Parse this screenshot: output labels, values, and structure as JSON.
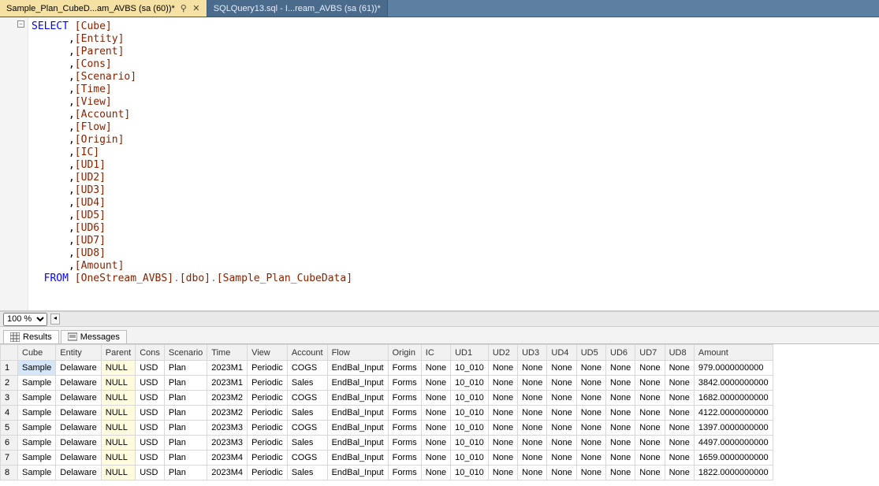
{
  "tabs": [
    {
      "label": "Sample_Plan_CubeD...am_AVBS (sa (60))*",
      "active": true,
      "pinned": true
    },
    {
      "label": "SQLQuery13.sql - I...ream_AVBS (sa (61))*",
      "active": false,
      "pinned": false
    }
  ],
  "editor": {
    "select_kw": "SELECT",
    "from_kw": "FROM",
    "first_col": "Cube",
    "columns_after": [
      "Entity",
      "Parent",
      "Cons",
      "Scenario",
      "Time",
      "View",
      "Account",
      "Flow",
      "Origin",
      "IC",
      "UD1",
      "UD2",
      "UD3",
      "UD4",
      "UD5",
      "UD6",
      "UD7",
      "UD8",
      "Amount"
    ],
    "from_db": "OneStream_AVBS",
    "from_schema": "dbo",
    "from_table": "Sample_Plan_CubeData"
  },
  "zoom": {
    "value": "100 %"
  },
  "result_tabs": {
    "results_label": "Results",
    "messages_label": "Messages"
  },
  "grid": {
    "headers": [
      "",
      "Cube",
      "Entity",
      "Parent",
      "Cons",
      "Scenario",
      "Time",
      "View",
      "Account",
      "Flow",
      "Origin",
      "IC",
      "UD1",
      "UD2",
      "UD3",
      "UD4",
      "UD5",
      "UD6",
      "UD7",
      "UD8",
      "Amount"
    ],
    "null_text": "NULL",
    "rows": [
      {
        "n": 1,
        "Cube": "Sample",
        "Entity": "Delaware",
        "Parent": null,
        "Cons": "USD",
        "Scenario": "Plan",
        "Time": "2023M1",
        "View": "Periodic",
        "Account": "COGS",
        "Flow": "EndBal_Input",
        "Origin": "Forms",
        "IC": "None",
        "UD1": "10_010",
        "UD2": "None",
        "UD3": "None",
        "UD4": "None",
        "UD5": "None",
        "UD6": "None",
        "UD7": "None",
        "UD8": "None",
        "Amount": "979.0000000000"
      },
      {
        "n": 2,
        "Cube": "Sample",
        "Entity": "Delaware",
        "Parent": null,
        "Cons": "USD",
        "Scenario": "Plan",
        "Time": "2023M1",
        "View": "Periodic",
        "Account": "Sales",
        "Flow": "EndBal_Input",
        "Origin": "Forms",
        "IC": "None",
        "UD1": "10_010",
        "UD2": "None",
        "UD3": "None",
        "UD4": "None",
        "UD5": "None",
        "UD6": "None",
        "UD7": "None",
        "UD8": "None",
        "Amount": "3842.0000000000"
      },
      {
        "n": 3,
        "Cube": "Sample",
        "Entity": "Delaware",
        "Parent": null,
        "Cons": "USD",
        "Scenario": "Plan",
        "Time": "2023M2",
        "View": "Periodic",
        "Account": "COGS",
        "Flow": "EndBal_Input",
        "Origin": "Forms",
        "IC": "None",
        "UD1": "10_010",
        "UD2": "None",
        "UD3": "None",
        "UD4": "None",
        "UD5": "None",
        "UD6": "None",
        "UD7": "None",
        "UD8": "None",
        "Amount": "1682.0000000000"
      },
      {
        "n": 4,
        "Cube": "Sample",
        "Entity": "Delaware",
        "Parent": null,
        "Cons": "USD",
        "Scenario": "Plan",
        "Time": "2023M2",
        "View": "Periodic",
        "Account": "Sales",
        "Flow": "EndBal_Input",
        "Origin": "Forms",
        "IC": "None",
        "UD1": "10_010",
        "UD2": "None",
        "UD3": "None",
        "UD4": "None",
        "UD5": "None",
        "UD6": "None",
        "UD7": "None",
        "UD8": "None",
        "Amount": "4122.0000000000"
      },
      {
        "n": 5,
        "Cube": "Sample",
        "Entity": "Delaware",
        "Parent": null,
        "Cons": "USD",
        "Scenario": "Plan",
        "Time": "2023M3",
        "View": "Periodic",
        "Account": "COGS",
        "Flow": "EndBal_Input",
        "Origin": "Forms",
        "IC": "None",
        "UD1": "10_010",
        "UD2": "None",
        "UD3": "None",
        "UD4": "None",
        "UD5": "None",
        "UD6": "None",
        "UD7": "None",
        "UD8": "None",
        "Amount": "1397.0000000000"
      },
      {
        "n": 6,
        "Cube": "Sample",
        "Entity": "Delaware",
        "Parent": null,
        "Cons": "USD",
        "Scenario": "Plan",
        "Time": "2023M3",
        "View": "Periodic",
        "Account": "Sales",
        "Flow": "EndBal_Input",
        "Origin": "Forms",
        "IC": "None",
        "UD1": "10_010",
        "UD2": "None",
        "UD3": "None",
        "UD4": "None",
        "UD5": "None",
        "UD6": "None",
        "UD7": "None",
        "UD8": "None",
        "Amount": "4497.0000000000"
      },
      {
        "n": 7,
        "Cube": "Sample",
        "Entity": "Delaware",
        "Parent": null,
        "Cons": "USD",
        "Scenario": "Plan",
        "Time": "2023M4",
        "View": "Periodic",
        "Account": "COGS",
        "Flow": "EndBal_Input",
        "Origin": "Forms",
        "IC": "None",
        "UD1": "10_010",
        "UD2": "None",
        "UD3": "None",
        "UD4": "None",
        "UD5": "None",
        "UD6": "None",
        "UD7": "None",
        "UD8": "None",
        "Amount": "1659.0000000000"
      },
      {
        "n": 8,
        "Cube": "Sample",
        "Entity": "Delaware",
        "Parent": null,
        "Cons": "USD",
        "Scenario": "Plan",
        "Time": "2023M4",
        "View": "Periodic",
        "Account": "Sales",
        "Flow": "EndBal_Input",
        "Origin": "Forms",
        "IC": "None",
        "UD1": "10_010",
        "UD2": "None",
        "UD3": "None",
        "UD4": "None",
        "UD5": "None",
        "UD6": "None",
        "UD7": "None",
        "UD8": "None",
        "Amount": "1822.0000000000"
      }
    ]
  }
}
